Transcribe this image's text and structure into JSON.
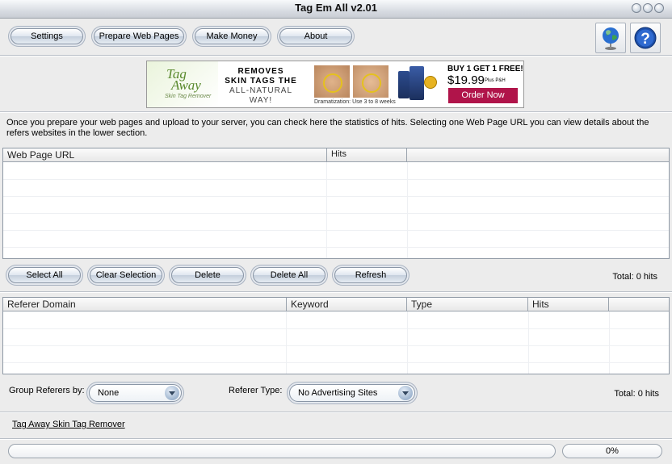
{
  "window": {
    "title": "Tag Em All v2.01"
  },
  "toolbar": {
    "settings": "Settings",
    "prepare": "Prepare Web Pages",
    "make_money": "Make Money",
    "about": "About"
  },
  "banner": {
    "logo_line1": "Tag",
    "logo_line2": "Away",
    "logo_sub": "Skin Tag Remover",
    "headline1": "REMOVES",
    "headline2": "SKIN TAGS THE",
    "headline3": "ALL-NATURAL",
    "headline4": "WAY!",
    "caption": "Dramatization: Use 3 to 8 weeks",
    "offer": "BUY 1 GET 1 FREE!",
    "price": "$19.99",
    "price_note": "Plus P&H",
    "cta": "Order Now"
  },
  "info_text": "Once you prepare your web pages and upload to your server, you can check here the statistics of hits. Selecting one Web Page URL you can view details about the refers websites in the lower section.",
  "pages_table": {
    "columns": [
      "Web Page URL",
      "Hits"
    ],
    "rows": []
  },
  "actions": {
    "select_all": "Select All",
    "clear_selection": "Clear Selection",
    "delete": "Delete",
    "delete_all": "Delete All",
    "refresh": "Refresh",
    "total": "Total: 0 hits"
  },
  "referer_table": {
    "columns": [
      "Referer Domain",
      "Keyword",
      "Type",
      "Hits"
    ],
    "rows": []
  },
  "filters": {
    "group_label": "Group Referers by:",
    "group_value": "None",
    "type_label": "Referer Type:",
    "type_value": "No Advertising Sites",
    "total": "Total: 0 hits"
  },
  "footer": {
    "link": "Tag Away Skin Tag Remover",
    "progress": "0%"
  },
  "colors": {
    "cta": "#b0144a",
    "logo": "#5a8a2e"
  }
}
